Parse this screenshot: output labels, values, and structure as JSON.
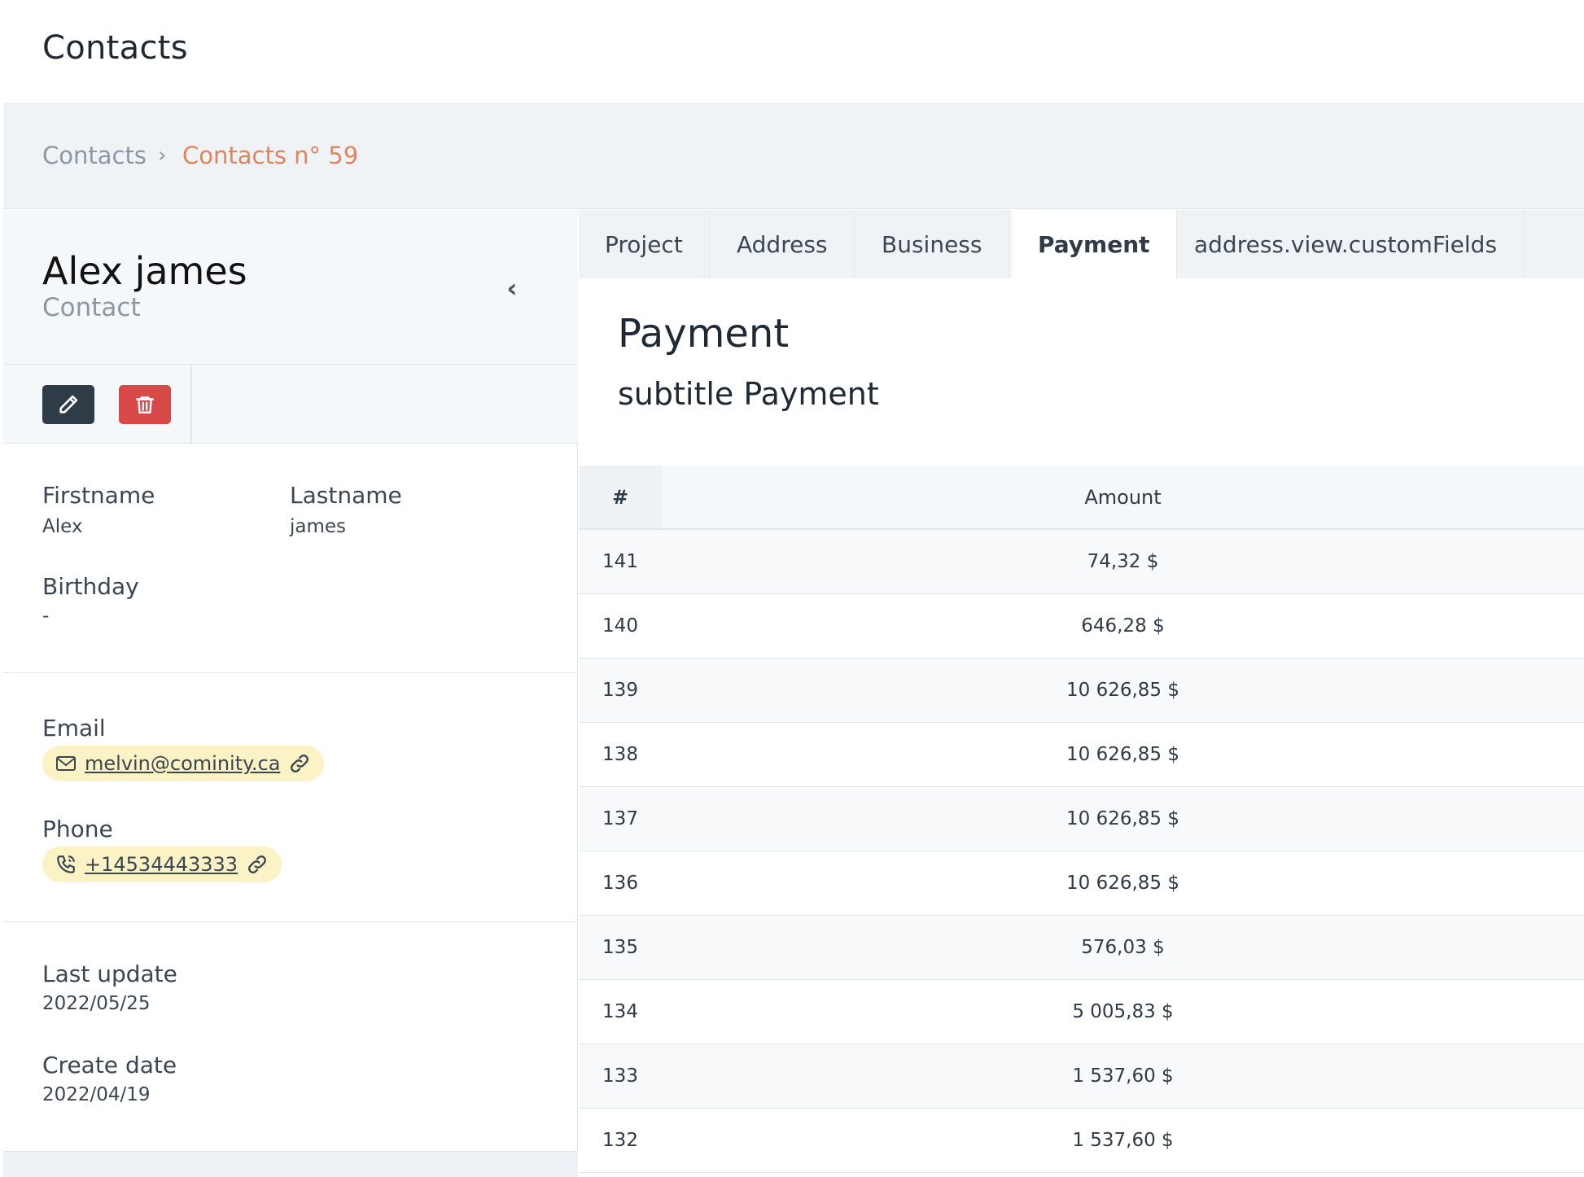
{
  "header": {
    "title": "Contacts"
  },
  "breadcrumb": {
    "home": "Contacts",
    "separator": "›",
    "current": "Contacts n° 59"
  },
  "profile": {
    "name": "Alex james",
    "role": "Contact",
    "collapse_icon": "‹"
  },
  "actions": {
    "edit_icon": "pencil-icon",
    "delete_icon": "trash-icon"
  },
  "fields": {
    "firstname_label": "Firstname",
    "firstname_value": "Alex",
    "lastname_label": "Lastname",
    "lastname_value": "james",
    "birthday_label": "Birthday",
    "birthday_value": "-",
    "email_label": "Email",
    "email_value": "melvin@cominity.ca",
    "phone_label": "Phone",
    "phone_value": "+14534443333",
    "last_update_label": "Last update",
    "last_update_value": "2022/05/25",
    "create_date_label": "Create date",
    "create_date_value": "2022/04/19"
  },
  "tabs": [
    {
      "label": "Project"
    },
    {
      "label": "Address"
    },
    {
      "label": "Business"
    },
    {
      "label": "Payment",
      "active": true
    },
    {
      "label": "address.view.customFields"
    }
  ],
  "payment": {
    "title": "Payment",
    "subtitle": "subtitle Payment",
    "columns": [
      "#",
      "Amount"
    ],
    "rows": [
      {
        "num": "141",
        "amount": "74,32 $"
      },
      {
        "num": "140",
        "amount": "646,28 $"
      },
      {
        "num": "139",
        "amount": "10 626,85 $"
      },
      {
        "num": "138",
        "amount": "10 626,85 $"
      },
      {
        "num": "137",
        "amount": "10 626,85 $"
      },
      {
        "num": "136",
        "amount": "10 626,85 $"
      },
      {
        "num": "135",
        "amount": "576,03 $"
      },
      {
        "num": "134",
        "amount": "5 005,83 $"
      },
      {
        "num": "133",
        "amount": "1 537,60 $"
      },
      {
        "num": "132",
        "amount": "1 537,60 $"
      }
    ]
  },
  "colors": {
    "accent": "#e0845e",
    "edit_button": "#2f3b46",
    "delete_button": "#d9494a",
    "pill_bg": "#fbf2c6"
  }
}
